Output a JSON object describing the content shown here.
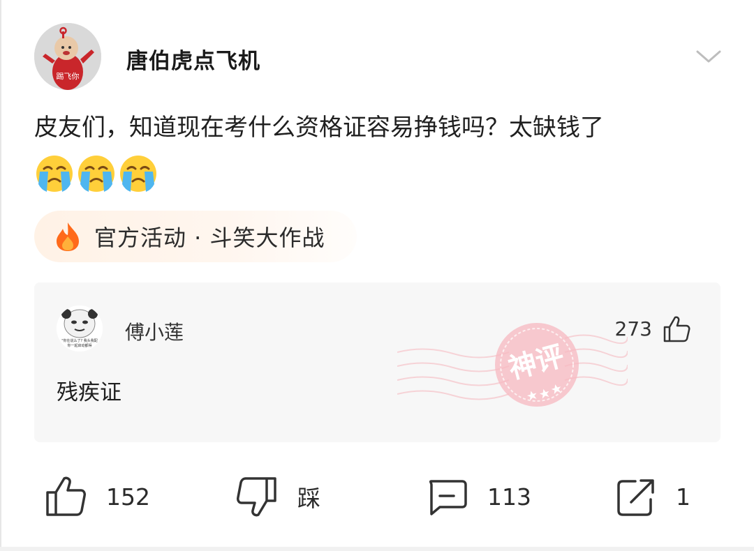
{
  "post": {
    "author": "唐伯虎点飞机",
    "avatar_caption": "踢飞你",
    "text": "皮友们，知道现在考什么资格证容易挣钱吗？太缺钱了",
    "emojis": [
      "crying-face",
      "crying-face",
      "crying-face"
    ],
    "activity_tag": "官方活动 · 斗笑大作战"
  },
  "hot_comment": {
    "author": "傅小莲",
    "likes": "273",
    "text": "残疾证",
    "stamp_text": "神评",
    "avatar_caption_line1": "\"你在说么了? 我头我配",
    "avatar_caption_line2": "你一起启动都得"
  },
  "actions": {
    "like_count": "152",
    "dislike_label": "踩",
    "comment_count": "113",
    "share_count": "1"
  },
  "colors": {
    "accent_stamp": "#f28b96",
    "flame_outer": "#ff6a1a",
    "flame_inner": "#ffb03a",
    "tag_bg": "#fff2e6",
    "card_bg": "#f7f7f7"
  },
  "icons": [
    "chevron-down-icon",
    "fire-icon",
    "thumbs-up-icon",
    "thumbs-down-icon",
    "comment-icon",
    "share-icon"
  ]
}
